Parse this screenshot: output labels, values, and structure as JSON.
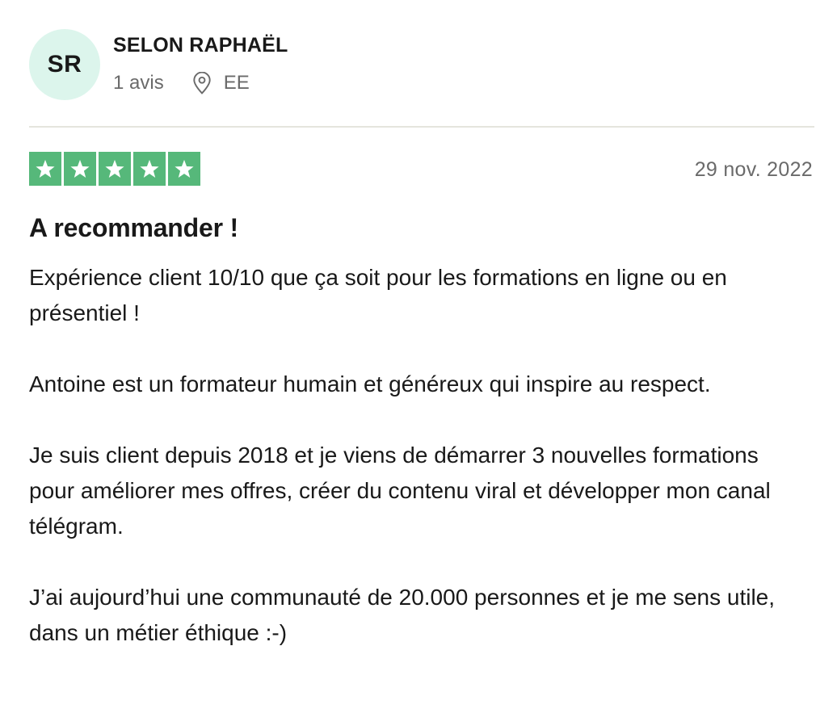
{
  "reviewer": {
    "initials": "SR",
    "name": "SELON RAPHAËL",
    "review_count": "1 avis",
    "country": "EE",
    "avatar_color": "#dcf5ec"
  },
  "review": {
    "rating": 5,
    "max_rating": 5,
    "star_color": "#56b87a",
    "date": "29 nov. 2022",
    "title": "A recommander !",
    "paragraphs": [
      "Expérience client 10/10 que ça soit pour les formations en ligne ou en présentiel !",
      "Antoine est un formateur humain et généreux qui inspire au respect.",
      "Je suis client depuis 2018 et je viens de démarrer 3 nouvelles formations pour améliorer mes offres, créer du contenu viral et développer mon canal télégram.",
      "J’ai aujourd’hui une communauté de 20.000 personnes et je me sens utile, dans un métier éthique :-)"
    ]
  },
  "icons": {
    "location": "location-pin-icon",
    "star": "star-icon"
  }
}
